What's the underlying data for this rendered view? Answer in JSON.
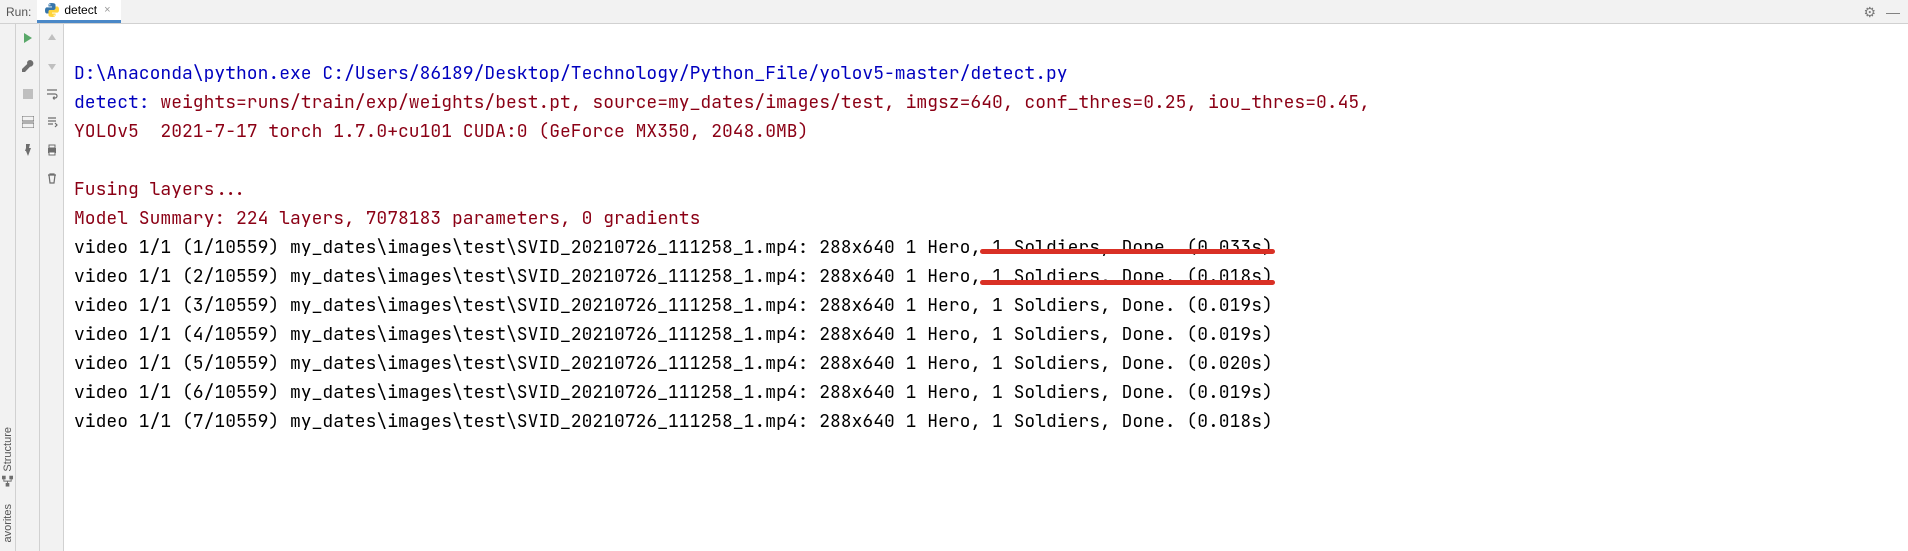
{
  "header": {
    "run_label": "Run:",
    "tab_label": "detect",
    "gear": "⚙",
    "minimize": "—"
  },
  "sidebar": {
    "structure": "Structure",
    "favorites": "avorites"
  },
  "console": {
    "line1": "D:\\Anaconda\\python.exe C:/Users/86189/Desktop/Technology/Python_File/yolov5-master/detect.py",
    "line2_prefix": "detect: ",
    "line2_rest": "weights=runs/train/exp/weights/best.pt, source=my_dates/images/test, imgsz=640, conf_thres=0.25, iou_thres=0.45,",
    "line3": "YOLOv5  2021-7-17 torch 1.7.0+cu101 CUDA:0 (GeForce MX350, 2048.0MB)",
    "line5": "Fusing layers... ",
    "line6": "Model Summary: 224 layers, 7078183 parameters, 0 gradients",
    "v1": "video 1/1 (1/10559) my_dates\\images\\test\\SVID_20210726_111258_1.mp4: 288x640 1 Hero, 1 Soldiers, Done. (0.033s)",
    "v2": "video 1/1 (2/10559) my_dates\\images\\test\\SVID_20210726_111258_1.mp4: 288x640 1 Hero, 1 Soldiers, Done. (0.018s)",
    "v3": "video 1/1 (3/10559) my_dates\\images\\test\\SVID_20210726_111258_1.mp4: 288x640 1 Hero, 1 Soldiers, Done. (0.019s)",
    "v4": "video 1/1 (4/10559) my_dates\\images\\test\\SVID_20210726_111258_1.mp4: 288x640 1 Hero, 1 Soldiers, Done. (0.019s)",
    "v5": "video 1/1 (5/10559) my_dates\\images\\test\\SVID_20210726_111258_1.mp4: 288x640 1 Hero, 1 Soldiers, Done. (0.020s)",
    "v6": "video 1/1 (6/10559) my_dates\\images\\test\\SVID_20210726_111258_1.mp4: 288x640 1 Hero, 1 Soldiers, Done. (0.019s)",
    "v7": "video 1/1 (7/10559) my_dates\\images\\test\\SVID_20210726_111258_1.mp4: 288x640 1 Hero, 1 Soldiers, Done. (0.018s)"
  }
}
